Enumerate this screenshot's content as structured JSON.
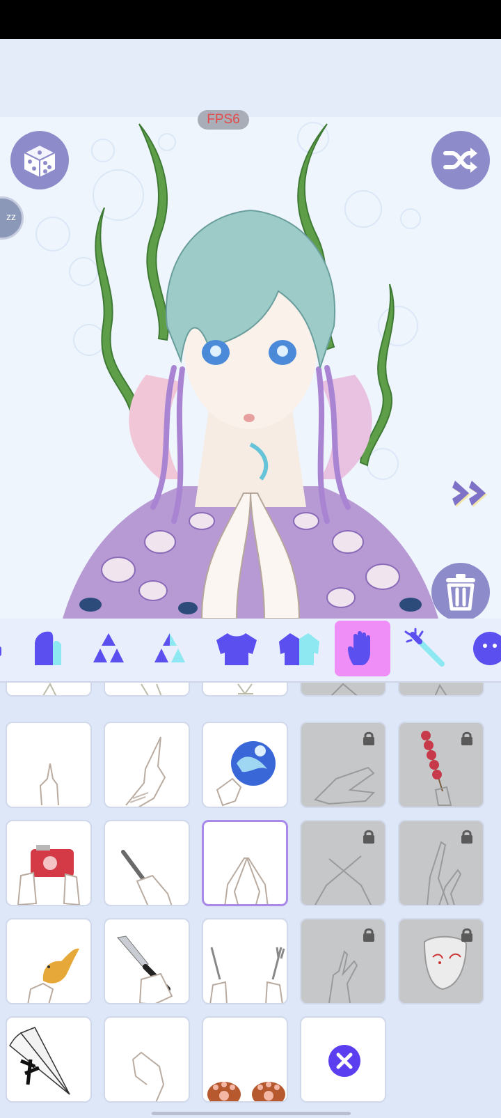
{
  "app": {
    "fps_label": "FPS6",
    "edge_badge": "zz"
  },
  "buttons": {
    "random": "dice-icon",
    "shuffle": "shuffle-icon",
    "delete": "trash-icon",
    "next": "double-chevron-right-icon"
  },
  "toolbar": {
    "categories": [
      {
        "name": "hair-icon",
        "selected": false
      },
      {
        "name": "triangle-pattern-icon",
        "selected": false
      },
      {
        "name": "triangle-pattern-alt-icon",
        "selected": false
      },
      {
        "name": "top-clothing-icon",
        "selected": false
      },
      {
        "name": "jacket-icon",
        "selected": false
      },
      {
        "name": "hand-icon",
        "selected": true
      },
      {
        "name": "magic-wand-icon",
        "selected": false
      },
      {
        "name": "face-icon",
        "selected": false
      }
    ]
  },
  "colors": {
    "accent": "#5b4ff0",
    "active_tab": "#f08ef7",
    "round_button": "#8d8bc9"
  },
  "hand_items": {
    "rows": [
      [
        "hand-pose",
        "hand-pose",
        "hand-pose",
        "hand-pose-locked",
        "hand-pose-locked"
      ],
      [
        "pointing-hand",
        "raised-finger",
        "crystal-ball-hand",
        "clasped-hands-locked",
        "candied-fruit-skewer-locked"
      ],
      [
        "camera-hands",
        "phone-hand",
        "prayer-hands-selected",
        "crossed-fingers-locked",
        "hands-raised-locked"
      ],
      [
        "bird-on-hand",
        "knife-hand",
        "knife-and-fork",
        "finger-pose-locked",
        "mask-hand-locked"
      ],
      [
        "fan-hand",
        "open-hand",
        "paw-gloves",
        "remove-item"
      ]
    ]
  }
}
